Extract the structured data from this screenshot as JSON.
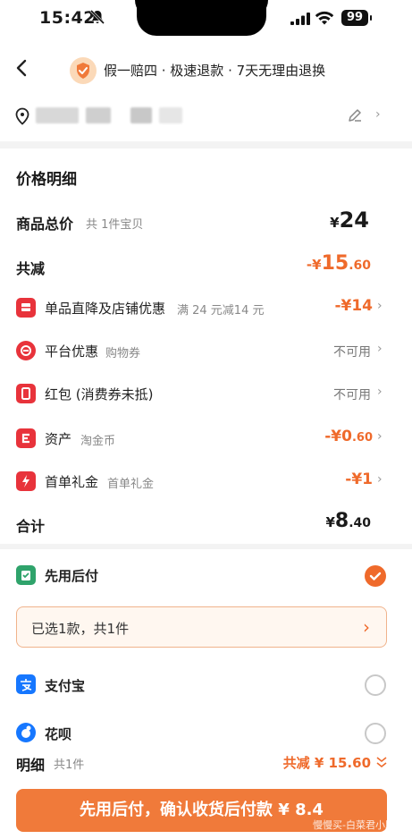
{
  "status_bar": {
    "time": "15:42",
    "battery": "99"
  },
  "header": {
    "title": "假一赔四 · 极速退款 · 7天无理由退换"
  },
  "price": {
    "section_title": "价格明细",
    "total": {
      "label": "商品总价",
      "sub": "共 1件宝贝",
      "currency": "¥",
      "amount": "24"
    },
    "discount_total": {
      "label": "共减",
      "value_prefix": "-¥",
      "value_int": "15",
      "value_dec": ".60"
    },
    "items": [
      {
        "label": "单品直降及店铺优惠",
        "sub": "满 24 元减14 元",
        "value": "-¥14",
        "icon": "store-discount-icon"
      },
      {
        "label": "平台优惠",
        "sub": "购物券",
        "value": "不可用",
        "icon": "platform-coupon-icon"
      },
      {
        "label": "红包 (消费券未抵)",
        "sub": "",
        "value": "不可用",
        "icon": "red-packet-icon"
      },
      {
        "label": "资产",
        "sub": "淘金币",
        "value_prefix": "-¥",
        "value_int": "0",
        "value_dec": ".60",
        "icon": "gold-coin-icon"
      },
      {
        "label": "首单礼金",
        "sub": "首单礼金",
        "value": "-¥1",
        "icon": "first-order-gift-icon"
      }
    ],
    "subtotal": {
      "label": "合计",
      "currency": "¥",
      "value_int": "8",
      "value_dec": ".40"
    }
  },
  "payment": {
    "options": [
      {
        "label": "先用后付",
        "selected": true,
        "icon": "pay-later-icon"
      },
      {
        "label": "支付宝",
        "selected": false,
        "icon": "alipay-icon"
      },
      {
        "label": "花呗",
        "selected": false,
        "icon": "huabei-icon"
      }
    ],
    "selected_box": {
      "text": "已选1款，共1件"
    }
  },
  "summary": {
    "label": "明细",
    "sub": "共1件",
    "discount": "共减 ¥ 15.60"
  },
  "cta": {
    "label": "先用后付，确认收货后付款 ¥ 8.4"
  },
  "watermark": "慢慢买-白菜君小助",
  "colors": {
    "accent": "#ef6a2b",
    "cta": "#f07a3a",
    "red_icon": "#e8333b",
    "alipay": "#1677ff"
  }
}
